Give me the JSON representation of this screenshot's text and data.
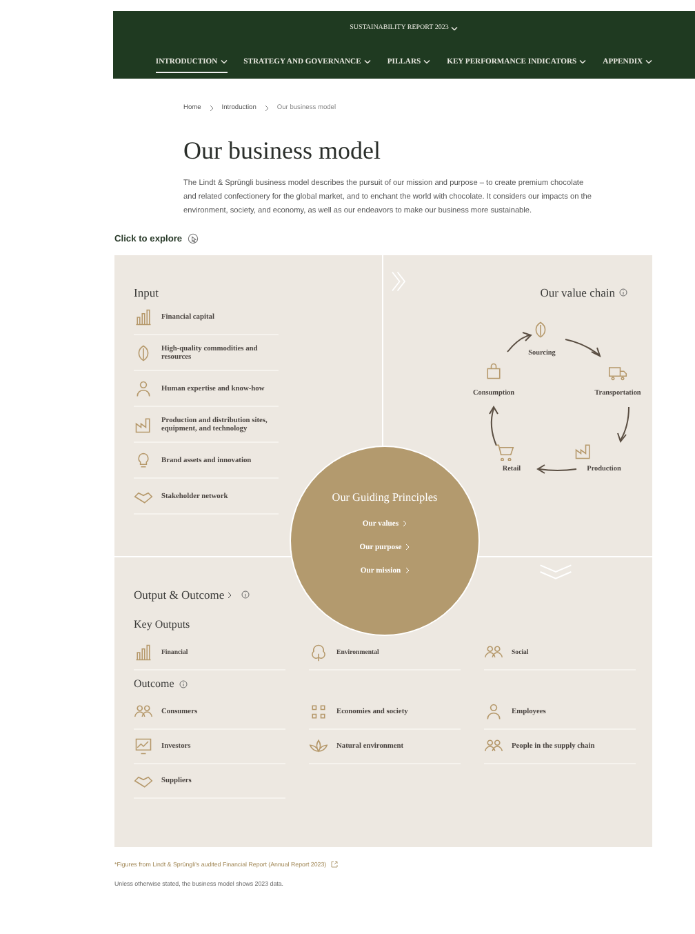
{
  "header": {
    "report_menu": "SUSTAINABILITY REPORT 2023",
    "nav": [
      {
        "label": "INTRODUCTION",
        "selected": true
      },
      {
        "label": "STRATEGY AND GOVERNANCE",
        "selected": false
      },
      {
        "label": "PILLARS",
        "selected": false
      },
      {
        "label": "KEY PERFORMANCE INDICATORS",
        "selected": false
      },
      {
        "label": "APPENDIX",
        "selected": false
      }
    ]
  },
  "breadcrumb": [
    "Home",
    "Introduction",
    "Our business model"
  ],
  "title": "Our business model",
  "intro": "The Lindt & Sprüngli business model describes the pursuit of our mission and purpose – to create premium chocolate and related confectionery for the global market, and to enchant the world with chocolate. It considers our impacts on the environment, society, and economy, as well as our endeavors to make our business more sustainable.",
  "explore_label": "Click to explore",
  "input": {
    "title": "Input",
    "items": [
      "Financial capital",
      "High-quality commodities and resources",
      "Human expertise and know-how",
      "Production and distribution sites, equipment, and technology",
      "Brand assets and innovation",
      "Stakeholder network"
    ]
  },
  "value_chain": {
    "title": "Our value chain",
    "steps": [
      "Sourcing",
      "Transportation",
      "Production",
      "Retail",
      "Consumption"
    ]
  },
  "guiding_principles": {
    "title": "Our Guiding Principles",
    "links": [
      "Our values",
      "Our purpose",
      "Our mission"
    ]
  },
  "output_outcome": {
    "title": "Output & Outcome",
    "key_outputs": {
      "title": "Key Outputs",
      "items": [
        "Financial",
        "Environmental",
        "Social"
      ]
    },
    "outcome": {
      "title": "Outcome",
      "items": [
        "Consumers",
        "Economies and society",
        "Employees",
        "Investors",
        "Natural environment",
        "People in the supply chain",
        "Suppliers"
      ]
    }
  },
  "footnotes": [
    "*Figures from Lindt & Sprüngli's audited Financial Report (Annual Report 2023)",
    "Unless otherwise stated, the business model shows 2023 data."
  ]
}
